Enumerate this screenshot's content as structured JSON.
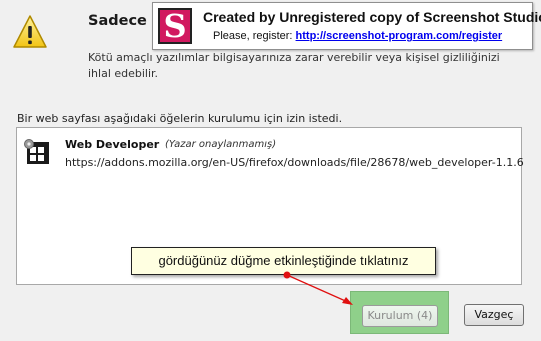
{
  "dialog": {
    "title": "Sadece ka",
    "warning_text": "Kötü amaçlı yazılımlar bilgisayarınıza zarar verebilir veya kişisel gizliliğinizi ihlal edebilir.",
    "request_label": "Bir web sayfası aşağıdaki öğelerin kurulumu için izin istedi."
  },
  "watermark": {
    "logo_letter": "S",
    "line1": "Created by Unregistered copy of Screenshot Studio.",
    "line2_prefix": "Please, register:",
    "link": "http://screenshot-program.com/register"
  },
  "addon": {
    "name": "Web Developer",
    "author_note": "(Yazar onaylanmamış)",
    "url": "https://addons.mozilla.org/en-US/firefox/downloads/file/28678/web_developer-1.1.6"
  },
  "tooltip": {
    "text": "gördüğünüz düğme etkinleştiğinde tıklatınız"
  },
  "buttons": {
    "install": "Kurulum (4)",
    "cancel": "Vazgeç"
  },
  "colors": {
    "highlight": "#8fd08a",
    "arrow": "#e01010",
    "tooltip_bg": "#ffffe1",
    "logo": "#d1195f"
  }
}
